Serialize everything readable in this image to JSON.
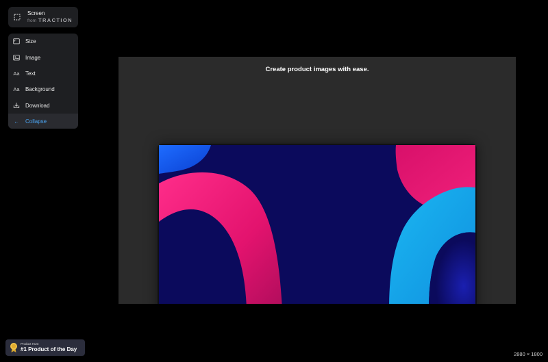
{
  "brand": {
    "title": "Screen",
    "from": "from",
    "name": "TRACTION",
    "icon": "selection-frame-icon"
  },
  "menu": {
    "items": [
      {
        "label": "Size",
        "icon": "size-icon"
      },
      {
        "label": "Image",
        "icon": "image-icon"
      },
      {
        "label": "Text",
        "icon": "text-icon",
        "glyph": "Aa"
      },
      {
        "label": "Background",
        "icon": "background-icon",
        "glyph": "Aa"
      },
      {
        "label": "Download",
        "icon": "download-icon"
      },
      {
        "label": "Collapse",
        "icon": "arrow-left-icon",
        "glyph": "←"
      }
    ]
  },
  "canvas": {
    "headline": "Create product images with ease.",
    "background_color": "#2b2b2b"
  },
  "badge": {
    "small": "Product Hunt",
    "big": "#1 Product of the Day"
  },
  "status": {
    "dimensions": "2880 × 1800"
  },
  "colors": {
    "accent": "#4aa3f0",
    "wallpaper_navy": "#0b0a5c",
    "wallpaper_pink": "#e3136e",
    "wallpaper_cyan": "#12a7e6"
  }
}
